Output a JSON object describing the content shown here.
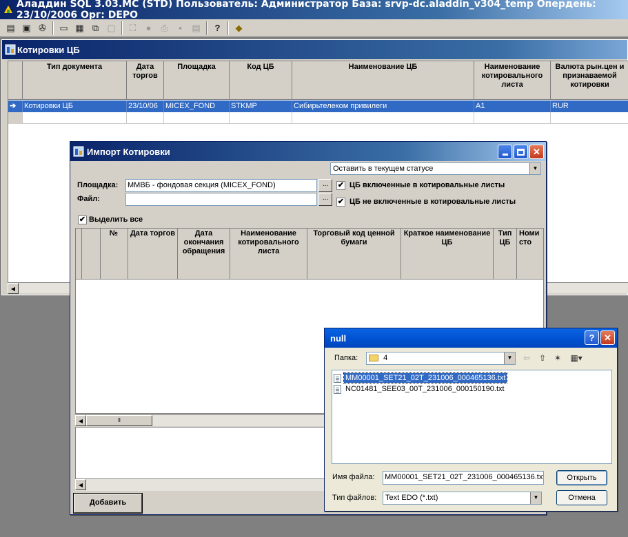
{
  "app": {
    "title": "Аладдин SQL 3.03.MC (STD)  Пользователь: Администратор База: srvp-dc.aladdin_v304_temp Опердень: 23/10/2006 Орг: DEPO"
  },
  "toolbar": {
    "items": [
      {
        "icon": "▤",
        "name": "report-icon"
      },
      {
        "icon": "▣",
        "name": "database-icon"
      },
      {
        "icon": "✇",
        "name": "filter-icon"
      },
      {
        "icon": "▭",
        "name": "form-view-icon"
      },
      {
        "icon": "▦",
        "name": "grid-view-icon"
      },
      {
        "icon": "⧉",
        "name": "window-cascade-icon"
      },
      {
        "icon": "▢",
        "name": "window-icon"
      },
      {
        "icon": "⛶",
        "name": "find-icon"
      },
      {
        "icon": "●",
        "name": "stop-icon"
      },
      {
        "icon": "⎙",
        "name": "print-icon"
      },
      {
        "icon": "▪",
        "name": "save-icon"
      },
      {
        "icon": "▤",
        "name": "calculator-icon"
      },
      {
        "icon": "?",
        "name": "help-icon"
      },
      {
        "icon": "◆",
        "name": "exit-icon"
      }
    ]
  },
  "child_window": {
    "title": "Котировки ЦБ",
    "columns": [
      "",
      "Тип документа",
      "Дата торгов",
      "Площадка",
      "Код ЦБ",
      "Наименование ЦБ",
      "Наименование котировального листа",
      "Валюта рын.цен и признаваемой котировки"
    ],
    "rows": [
      {
        "marker": "➔",
        "cells": [
          "Котировки ЦБ",
          "23/10/06",
          "MICEX_FOND",
          "STKMP",
          "Сибирьтелеком привилеги",
          "A1",
          "RUR"
        ]
      }
    ]
  },
  "import_dialog": {
    "title": "Импорт Котировки",
    "status_select": "Оставить в текущем статусе",
    "site_label": "Площадка:",
    "site_value": "ММВБ - фондовая секция (MICEX_FOND)",
    "file_label": "Файл:",
    "file_value": "",
    "browse_label": "...",
    "chk_included": "ЦБ включенные в котировальные листы",
    "chk_excluded": "ЦБ не включенные в котировальные листы",
    "select_all": "Выделить все",
    "columns": [
      "",
      "",
      "№",
      "Дата торгов",
      "Дата окончания обращения",
      "Наименование котировального листа",
      "Торговый код ценной бумаги",
      "Краткое наименование ЦБ",
      "Тип ЦБ",
      "Номи сто"
    ],
    "add_button": "Добавить"
  },
  "file_dialog": {
    "title": "null",
    "folder_label": "Папка:",
    "folder_value": "4",
    "files": [
      "MM00001_SET21_02T_231006_000465136.txt",
      "NC01481_SEE03_00T_231006_000150190.txt"
    ],
    "filename_label": "Имя файла:",
    "filename_value": "MM00001_SET21_02T_231006_000465136.txt",
    "filetype_label": "Тип файлов:",
    "filetype_value": "Text EDO (*.txt)",
    "open_button": "Открыть",
    "cancel_button": "Отмена"
  },
  "colors": {
    "title_bar": "#0a246a",
    "selection": "#316ac5",
    "face": "#d4d0c8",
    "workspace": "#808080"
  }
}
